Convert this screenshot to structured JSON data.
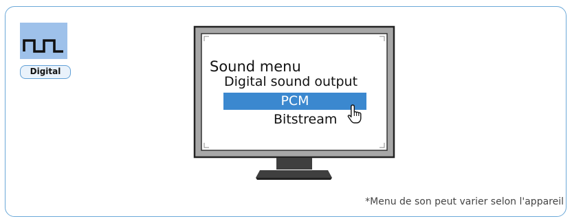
{
  "badge": {
    "label": "Digital",
    "icon": "square-wave-icon"
  },
  "tv": {
    "menu_title": "Sound menu",
    "menu_subtitle": "Digital sound output",
    "options": [
      {
        "label": "PCM",
        "selected": true
      },
      {
        "label": "Bitstream",
        "selected": false
      }
    ],
    "cursor_icon": "hand-pointer-icon"
  },
  "footnote": "*Menu de son peut varier selon l'appareil",
  "colors": {
    "panel_border": "#6aa8d8",
    "tile_fill": "#9ec1ea",
    "badge_fill": "#e9f2fb",
    "selected_option": "#3b88cf",
    "tv_frame": "#a7a7a7",
    "tv_stand": "#3f3f3f"
  }
}
